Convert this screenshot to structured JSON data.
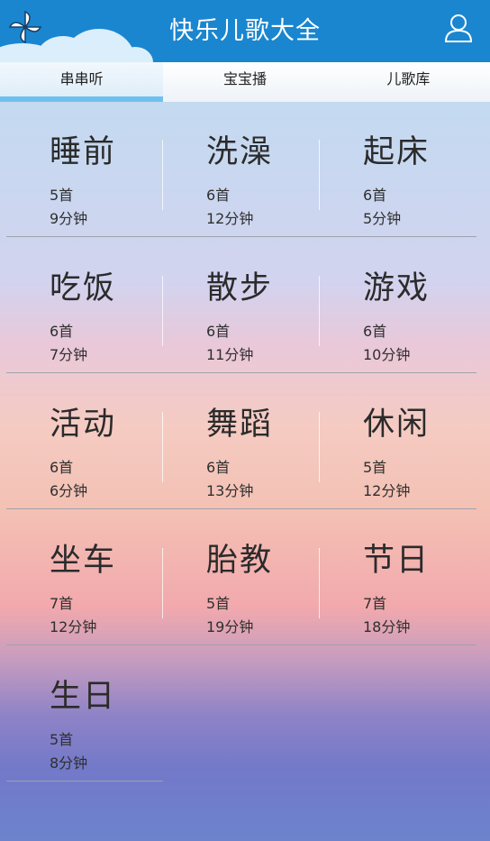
{
  "header": {
    "title": "快乐儿歌大全",
    "logo_icon": "pinwheel-icon",
    "user_icon": "user-icon",
    "background": "#1a86cf"
  },
  "tabs": [
    {
      "label": "串串听",
      "active": true
    },
    {
      "label": "宝宝播",
      "active": false
    },
    {
      "label": "儿歌库",
      "active": false
    }
  ],
  "categories": [
    {
      "name": "睡前",
      "count": "5首",
      "duration": "9分钟"
    },
    {
      "name": "洗澡",
      "count": "6首",
      "duration": "12分钟"
    },
    {
      "name": "起床",
      "count": "6首",
      "duration": "5分钟"
    },
    {
      "name": "吃饭",
      "count": "6首",
      "duration": "7分钟"
    },
    {
      "name": "散步",
      "count": "6首",
      "duration": "11分钟"
    },
    {
      "name": "游戏",
      "count": "6首",
      "duration": "10分钟"
    },
    {
      "name": "活动",
      "count": "6首",
      "duration": "6分钟"
    },
    {
      "name": "舞蹈",
      "count": "6首",
      "duration": "13分钟"
    },
    {
      "name": "休闲",
      "count": "5首",
      "duration": "12分钟"
    },
    {
      "name": "坐车",
      "count": "7首",
      "duration": "12分钟"
    },
    {
      "name": "胎教",
      "count": "5首",
      "duration": "19分钟"
    },
    {
      "name": "节日",
      "count": "7首",
      "duration": "18分钟"
    },
    {
      "name": "生日",
      "count": "5首",
      "duration": "8分钟"
    }
  ]
}
